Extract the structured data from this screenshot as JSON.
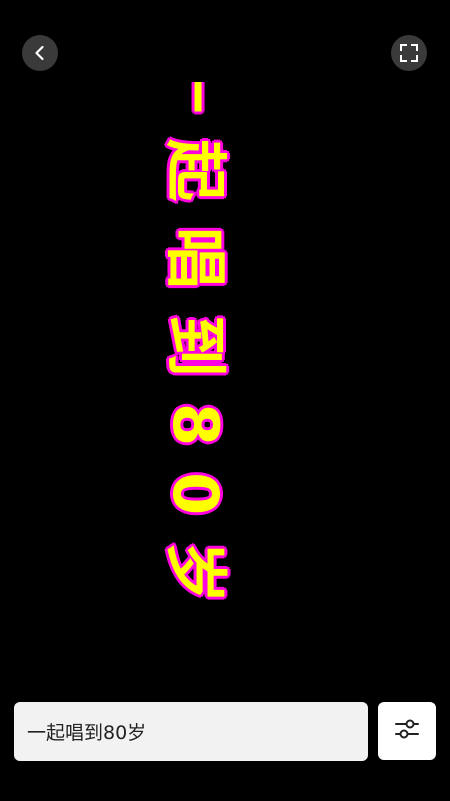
{
  "top_bar": {
    "back_icon": "chevron-left-icon",
    "fullscreen_icon": "fullscreen-icon"
  },
  "banner": {
    "text": "一起唱到80岁",
    "text_color": "#ffff00",
    "outline_color": "#ff00e0",
    "background": "#000000",
    "orientation": "vertical"
  },
  "input": {
    "value": "一起唱到80岁"
  },
  "settings": {
    "icon": "sliders-icon"
  }
}
